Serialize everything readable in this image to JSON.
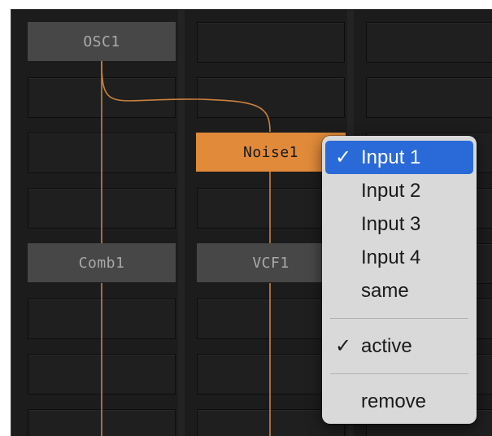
{
  "modules": {
    "osc1": "OSC1",
    "noise1": "Noise1",
    "comb1": "Comb1",
    "vcf1": "VCF1"
  },
  "colors": {
    "panel_bg": "#1c1c1c",
    "module_bg": "#474747",
    "module_text": "#a9a9a9",
    "selected_module_bg": "#e08a3a",
    "wire": "#c9823f",
    "menu_bg": "#d9d9d9",
    "menu_highlight": "#2a6ad8"
  },
  "context_menu": {
    "inputs": [
      {
        "label": "Input 1",
        "checked": true,
        "highlighted": true
      },
      {
        "label": "Input 2",
        "checked": false,
        "highlighted": false
      },
      {
        "label": "Input 3",
        "checked": false,
        "highlighted": false
      },
      {
        "label": "Input 4",
        "checked": false,
        "highlighted": false
      },
      {
        "label": "same",
        "checked": false,
        "highlighted": false
      }
    ],
    "active": {
      "label": "active",
      "checked": true
    },
    "remove": {
      "label": "remove"
    },
    "check_glyph": "✓"
  }
}
